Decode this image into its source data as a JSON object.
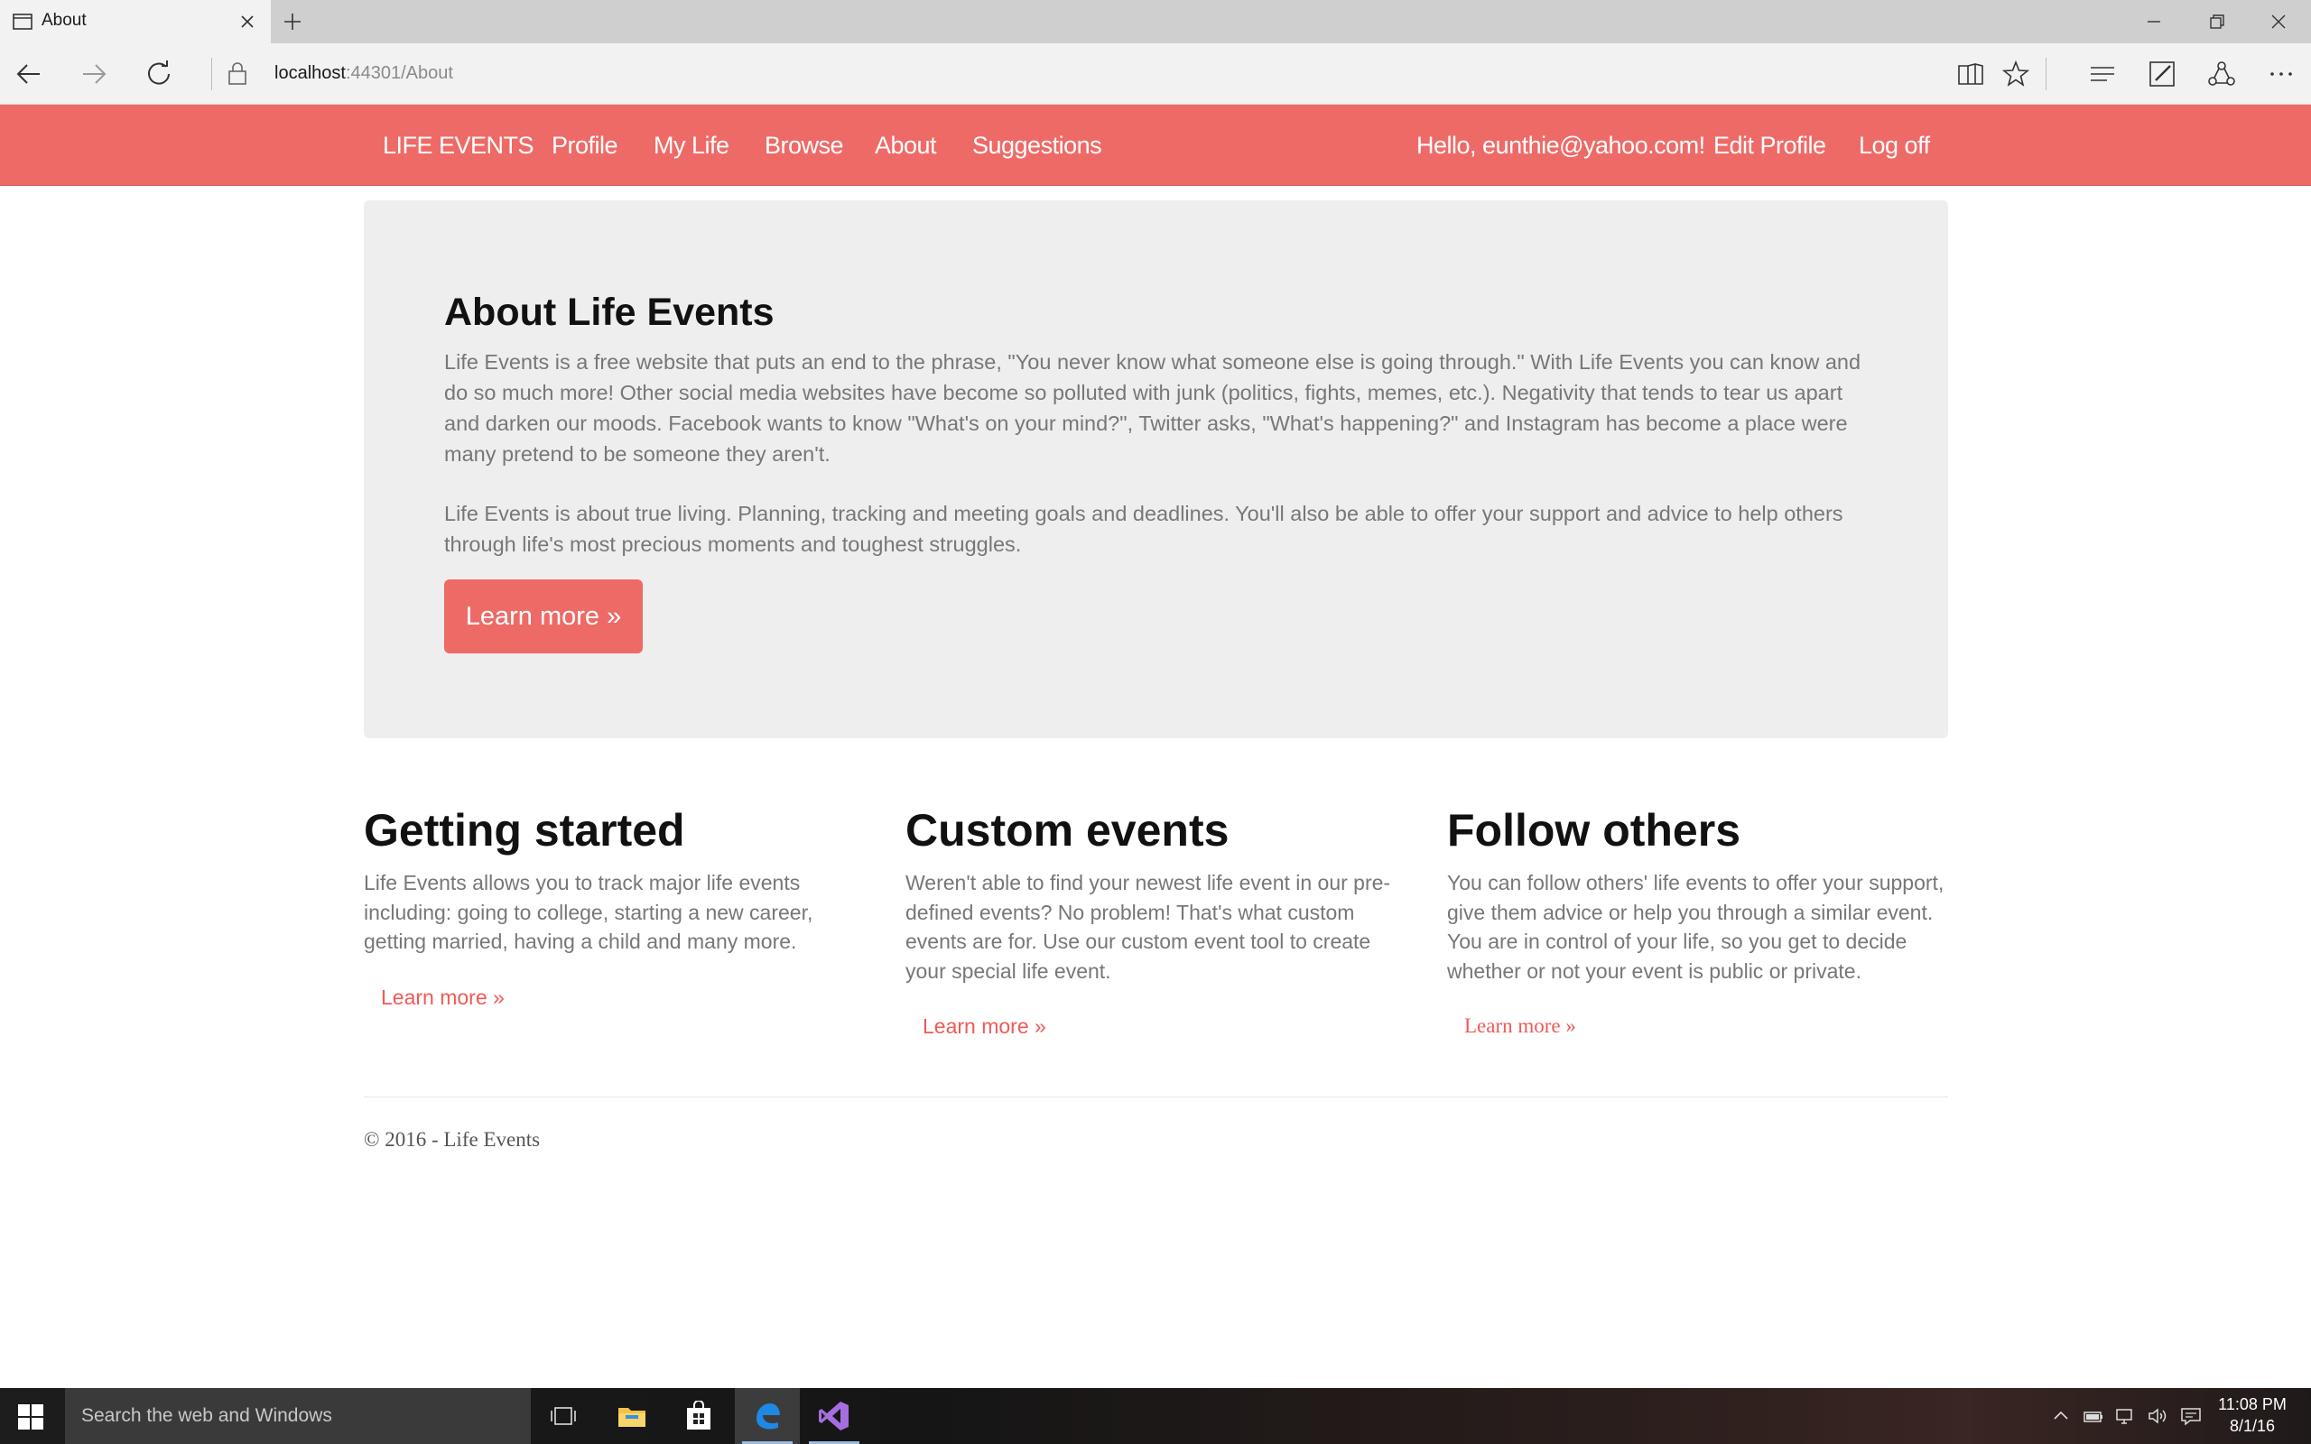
{
  "browser": {
    "tab_title": "About",
    "url_host": "localhost",
    "url_path": ":44301/About"
  },
  "navbar": {
    "brand": "LIFE EVENTS",
    "links": [
      "Profile",
      "My Life",
      "Browse",
      "About",
      "Suggestions"
    ],
    "greeting": "Hello, eunthie@yahoo.com!",
    "edit_profile": "Edit Profile",
    "log_off": "Log off"
  },
  "jumbotron": {
    "title": "About Life Events",
    "paragraph1": "Life Events is a free website that puts an end to the phrase, \"You never know what someone else is going through.\" With Life Events you can know and do so much more! Other social media websites have become so polluted with junk (politics, fights, memes, etc.). Negativity that tends to tear us apart and darken our moods. Facebook wants to know \"What's on your mind?\", Twitter asks, \"What's happening?\" and Instagram has become a place were many pretend to be someone they aren't.",
    "paragraph2": "Life Events is about true living. Planning, tracking and meeting goals and deadlines. You'll also be able to offer your support and advice to help others through life's most precious moments and toughest struggles.",
    "button": "Learn more »"
  },
  "columns": [
    {
      "title": "Getting started",
      "text": "Life Events allows you to track major life events including: going to college, starting a new career, getting married, having a child and many more.",
      "link": "Learn more »"
    },
    {
      "title": "Custom events",
      "text": "Weren't able to find your newest life event in our pre-defined events? No problem! That's what custom events are for. Use our custom event tool to create your special life event.",
      "link": "Learn more »"
    },
    {
      "title": "Follow others",
      "text": "You can follow others' life events to offer your support, give them advice or help you through a similar event. You are in control of your life, so you get to decide whether or not your event is public or private.",
      "link": "Learn more »"
    }
  ],
  "footer": "© 2016 - Life Events",
  "taskbar": {
    "search_placeholder": "Search the web and Windows",
    "time": "11:08 PM",
    "date": "8/1/16",
    "apps": [
      "task-view-icon",
      "file-explorer-icon",
      "store-icon",
      "edge-icon",
      "visual-studio-icon"
    ]
  },
  "colors": {
    "brand": "#ee6a67",
    "jumbotron_bg": "#eeeeee",
    "link": "#ee5a57"
  }
}
